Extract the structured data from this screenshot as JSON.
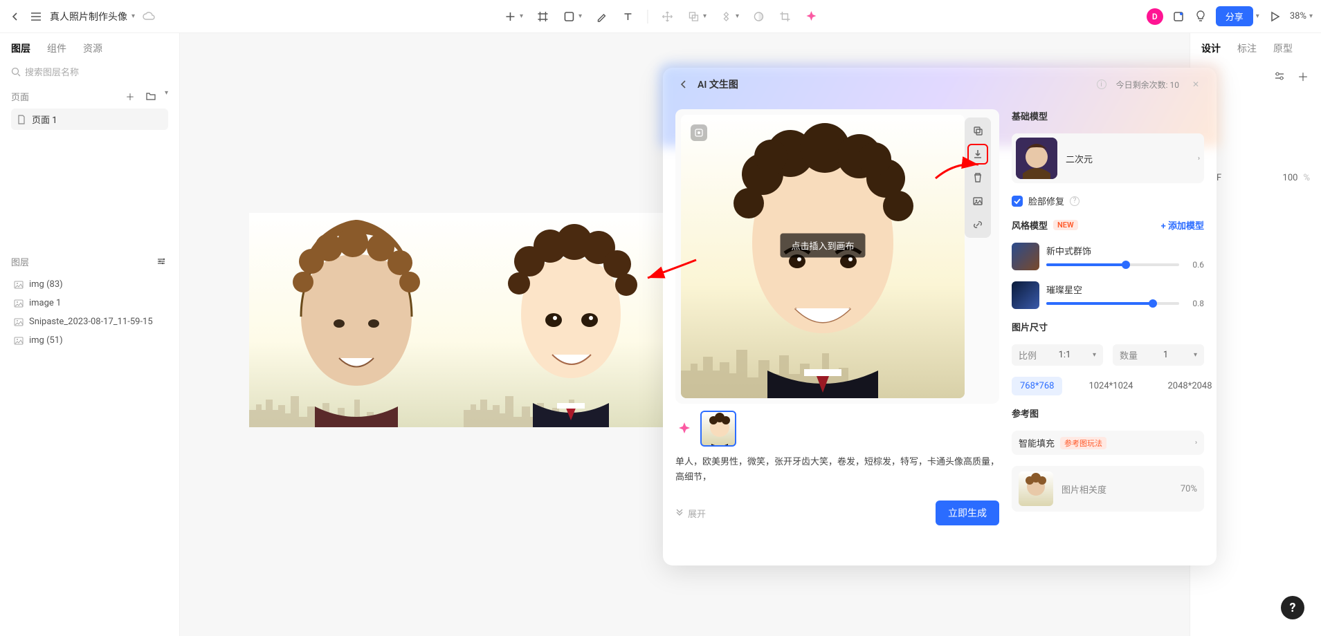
{
  "topbar": {
    "doc_title": "真人照片制作头像",
    "avatar_letter": "D",
    "share": "分享",
    "zoom": "38%"
  },
  "sidebar": {
    "tabs": {
      "layers": "图层",
      "components": "组件",
      "assets": "资源"
    },
    "search_placeholder": "搜索图层名称",
    "pages_label": "页面",
    "page1": "页面 1",
    "layers_label": "图层",
    "layer_items": [
      "img (83)",
      "image 1",
      "Snipaste_2023-08-17_11-59-15",
      "img (51)"
    ]
  },
  "rightbar": {
    "tabs": {
      "design": "设计",
      "annotate": "标注",
      "proto": "原型"
    },
    "color_hex": "EFEF",
    "opacity": "100",
    "opacity_unit": "%"
  },
  "ai": {
    "title": "AI 文生图",
    "remaining_label": "今日剩余次数: 10",
    "insert_label": "点击插入到画布",
    "prompt": "单人，欧美男性，微笑，张开牙齿大笑，卷发，短棕发，特写，卡通头像高质量，高细节，",
    "expand": "展开",
    "generate": "立即生成",
    "base_model_label": "基础模型",
    "base_model_name": "二次元",
    "face_fix": "脸部修复",
    "style_model_label": "风格模型",
    "new_badge": "NEW",
    "add_model": "+ 添加模型",
    "styles": [
      {
        "name": "新中式群饰",
        "value": "0.6",
        "fill": 60
      },
      {
        "name": "璀璨星空",
        "value": "0.8",
        "fill": 80
      }
    ],
    "size_label": "图片尺寸",
    "ratio_label": "比例",
    "ratio_value": "1:1",
    "count_label": "数量",
    "count_value": "1",
    "sizes": [
      "768*768",
      "1024*1024",
      "2048*2048"
    ],
    "ref_label": "参考图",
    "smart_fill": "智能填充",
    "smart_fill_tag": "参考图玩法",
    "ref_relevance": "图片相关度",
    "ref_relevance_val": "70%"
  }
}
